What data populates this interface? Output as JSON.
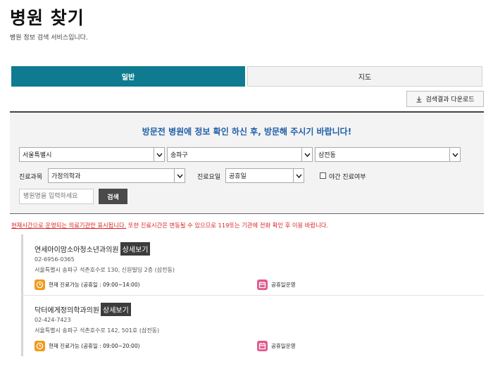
{
  "header": {
    "title": "병원 찾기",
    "subtitle": "병원 정보 검색 서비스입니다."
  },
  "tabs": [
    {
      "label": "일반",
      "active": true
    },
    {
      "label": "지도",
      "active": false
    }
  ],
  "download_label": "검색결과 다운로드",
  "search": {
    "notice": "방문전 병원에 정보 확인 하신 후, 방문해 주시기 바랍니다!",
    "city": "서울특별시",
    "district": "송파구",
    "dong": "삼전동",
    "dept_label": "진료과목",
    "dept_value": "가정의학과",
    "day_label": "진료요일",
    "day_value": "공휴일",
    "night_label": "야간 진료여부",
    "name_placeholder": "병원명을 입력하세요",
    "search_label": "검색"
  },
  "warning": {
    "part1": "현재시간으로 운영되는 의료기관만 표시됩니다.",
    "part2": " 또한 진료시간은 변동될 수 있으므로 119또는 기관에 전화 확인 후 이용 바랍니다."
  },
  "results": [
    {
      "name": "연세아이맘소아청소년과의원",
      "detail_label": "상세보기",
      "phone": "02-6956-0365",
      "address": "서울특별시 송파구 석촌호수로 130, 신원빌딩 2층 (삼전동)",
      "status": "현재 진료가능 (공휴일 : 09:00~14:00)",
      "holiday": "공휴일운영"
    },
    {
      "name": "닥터에게정의학과의원",
      "detail_label": "상세보기",
      "phone": "02-424-7423",
      "address": "서울특별시 송파구 석촌호수로 142, 501호 (삼전동)",
      "status": "현재 진료가능 (공휴일 : 09:00~20:00)",
      "holiday": "공휴일운영"
    }
  ],
  "colors": {
    "accent": "#0e7b91",
    "notice": "#1f5fa8",
    "warning": "#dd2222",
    "clock_icon": "#f19a1b",
    "calendar_icon": "#e05b8f"
  }
}
